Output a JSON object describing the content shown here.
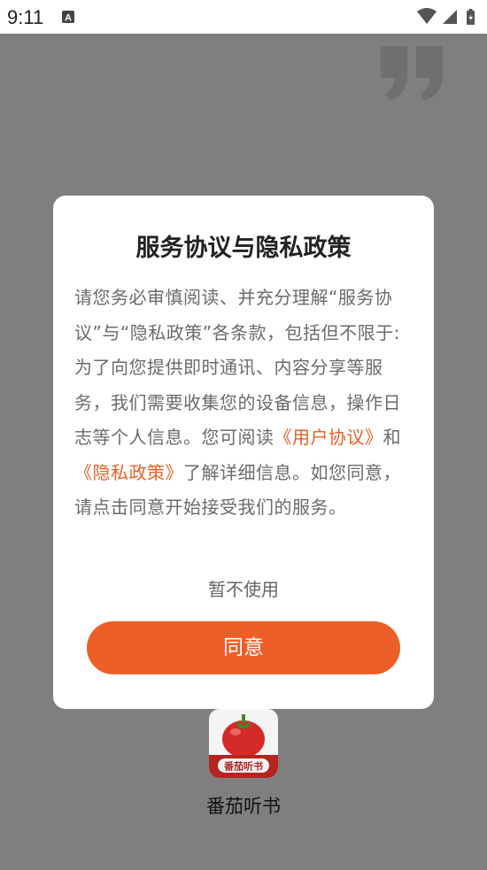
{
  "status": {
    "time": "9:11",
    "notification_icon": "text-a-icon",
    "icons": [
      "wifi-icon",
      "signal-icon",
      "battery-icon"
    ]
  },
  "dialog": {
    "title": "服务协议与隐私政策",
    "body_part1": "请您务必审慎阅读、并充分理解“服务协议”与“隐私政策”各条款，包括但不限于:为了向您提供即时通讯、内容分享等服务，我们需要收集您的设备信息，操作日志等个人信息。您可阅读",
    "link_user_agreement": "《用户协议》",
    "body_and": "和",
    "link_privacy_policy": "《隐私政策》",
    "body_part2": "了解详细信息。如您同意，请点击同意开始接受我们的服务。",
    "decline_label": "暂不使用",
    "agree_label": "同意"
  },
  "app": {
    "name": "番茄听书",
    "icon_label": "番茄听书"
  },
  "colors": {
    "accent": "#ee5f27",
    "overlay": "#7f7f7f",
    "link": "#ec5f26"
  }
}
